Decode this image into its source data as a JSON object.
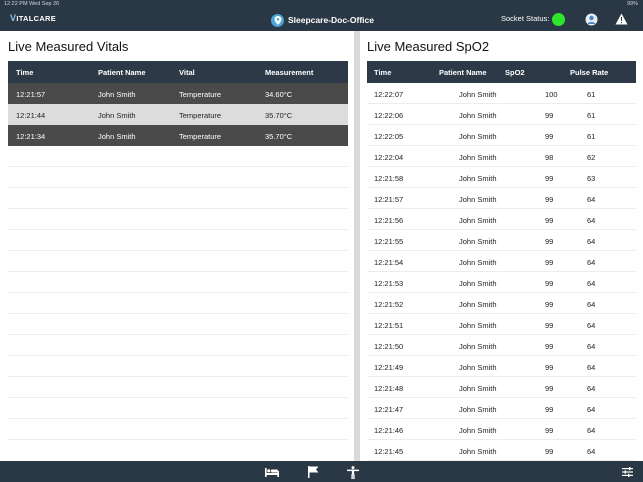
{
  "status_bar": {
    "time_date": "12:22 PM   Wed Sep 26",
    "battery": "99%"
  },
  "header": {
    "logo_text": "ITALCARE",
    "logo_letter": "V",
    "title": "Sleepcare-Doc-Office",
    "socket_label": "Socket Status:",
    "socket_color": "#2ee52b"
  },
  "vitals": {
    "title": "Live Measured Vitals",
    "columns": [
      "Time",
      "Patient Name",
      "Vital",
      "Measurement"
    ],
    "rows": [
      {
        "time": "12:21:57",
        "patient": "John Smith",
        "vital": "Temperature",
        "measurement": "34.60°C",
        "style": "dark"
      },
      {
        "time": "12:21:44",
        "patient": "John Smith",
        "vital": "Temperature",
        "measurement": "35.70°C",
        "style": "light"
      },
      {
        "time": "12:21:34",
        "patient": "John Smith",
        "vital": "Temperature",
        "measurement": "35.70°C",
        "style": "dark"
      }
    ]
  },
  "spo2": {
    "title": "Live Measured SpO2",
    "columns": [
      "Time",
      "Patient Name",
      "SpO2",
      "Pulse Rate"
    ],
    "rows": [
      {
        "time": "12:22:07",
        "patient": "John Smith",
        "spo2": "100",
        "pulse": "61"
      },
      {
        "time": "12:22:06",
        "patient": "John Smith",
        "spo2": "99",
        "pulse": "61"
      },
      {
        "time": "12:22:05",
        "patient": "John Smith",
        "spo2": "99",
        "pulse": "61"
      },
      {
        "time": "12:22:04",
        "patient": "John Smith",
        "spo2": "98",
        "pulse": "62"
      },
      {
        "time": "12:21:58",
        "patient": "John Smith",
        "spo2": "99",
        "pulse": "63"
      },
      {
        "time": "12:21:57",
        "patient": "John Smith",
        "spo2": "99",
        "pulse": "64"
      },
      {
        "time": "12:21:56",
        "patient": "John Smith",
        "spo2": "99",
        "pulse": "64"
      },
      {
        "time": "12:21:55",
        "patient": "John Smith",
        "spo2": "99",
        "pulse": "64"
      },
      {
        "time": "12:21:54",
        "patient": "John Smith",
        "spo2": "99",
        "pulse": "64"
      },
      {
        "time": "12:21:53",
        "patient": "John Smith",
        "spo2": "99",
        "pulse": "64"
      },
      {
        "time": "12:21:52",
        "patient": "John Smith",
        "spo2": "99",
        "pulse": "64"
      },
      {
        "time": "12:21:51",
        "patient": "John Smith",
        "spo2": "99",
        "pulse": "64"
      },
      {
        "time": "12:21:50",
        "patient": "John Smith",
        "spo2": "99",
        "pulse": "64"
      },
      {
        "time": "12:21:49",
        "patient": "John Smith",
        "spo2": "99",
        "pulse": "64"
      },
      {
        "time": "12:21:48",
        "patient": "John Smith",
        "spo2": "99",
        "pulse": "64"
      },
      {
        "time": "12:21:47",
        "patient": "John Smith",
        "spo2": "99",
        "pulse": "64"
      },
      {
        "time": "12:21:46",
        "patient": "John Smith",
        "spo2": "99",
        "pulse": "64"
      },
      {
        "time": "12:21:45",
        "patient": "John Smith",
        "spo2": "99",
        "pulse": "64"
      }
    ]
  },
  "bottom_tabs": [
    {
      "icon": "bed-icon"
    },
    {
      "icon": "flag-icon"
    },
    {
      "icon": "person-icon"
    },
    {
      "icon": "sliders-icon"
    }
  ]
}
